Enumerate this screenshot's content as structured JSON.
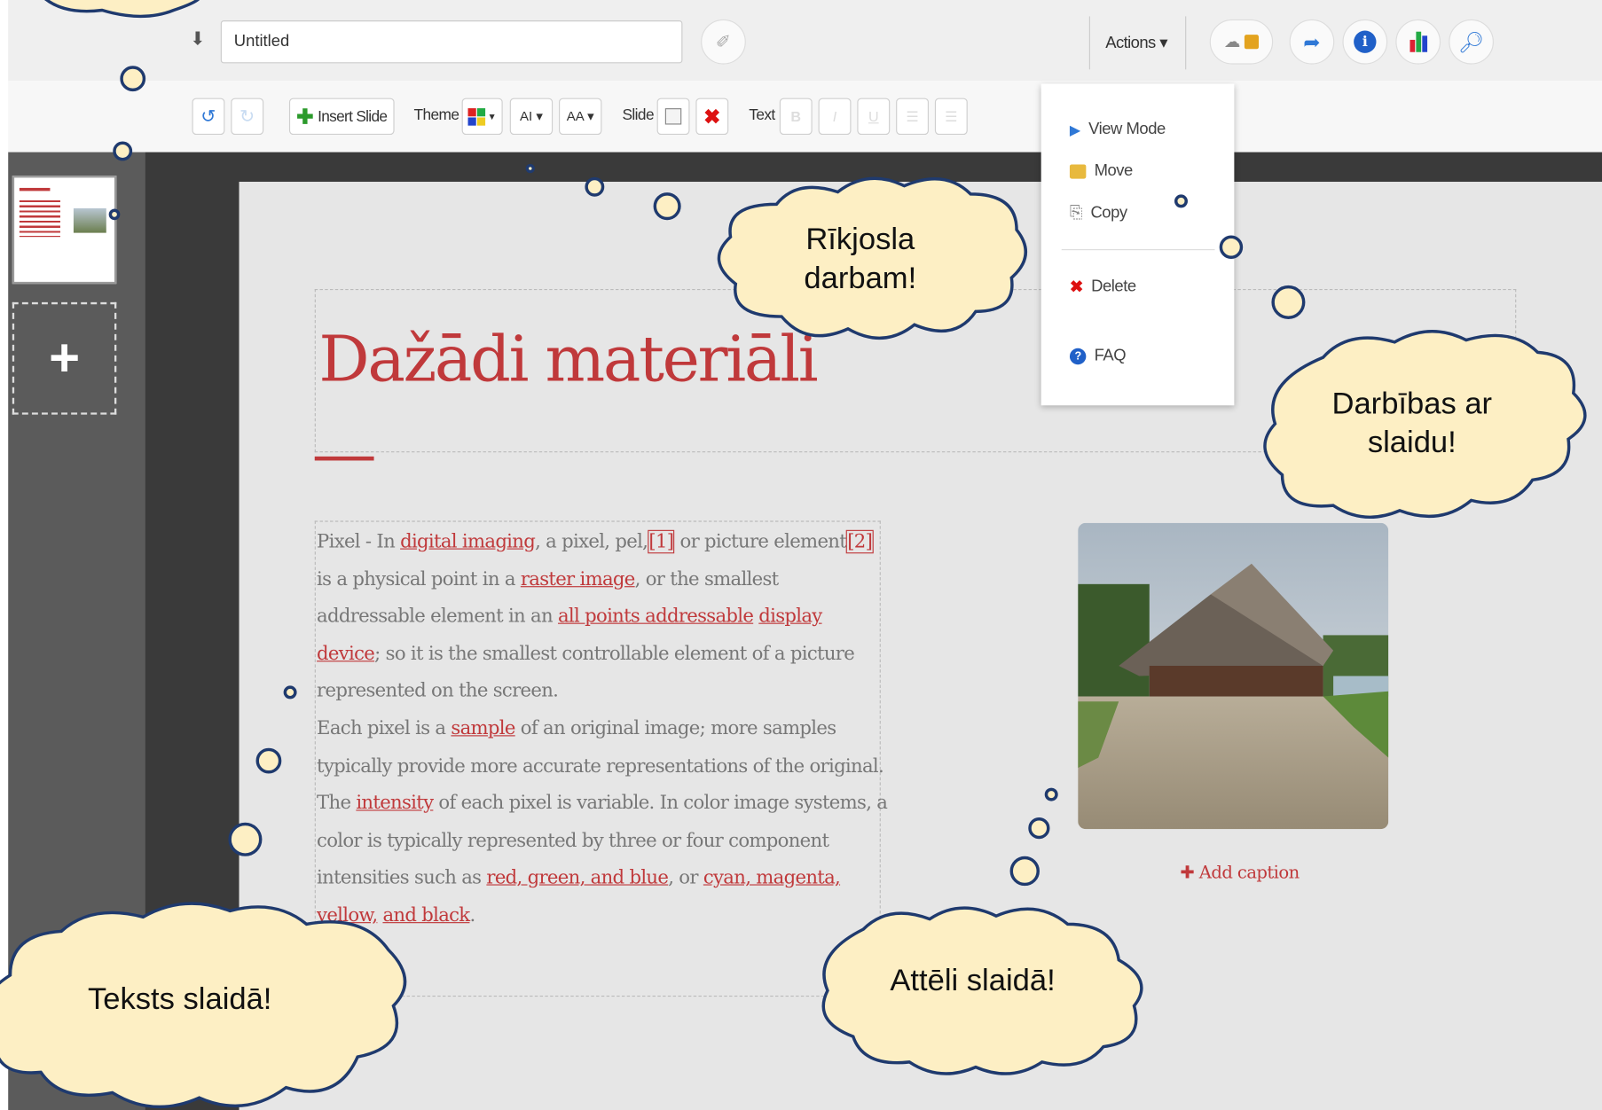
{
  "header": {
    "title_value": "Untitled",
    "actions_label": "Actions ▾"
  },
  "toolbar": {
    "insert_slide": "Insert Slide",
    "theme_label": "Theme",
    "font_btn": "AI ▾",
    "size_btn": "AA ▾",
    "slide_label": "Slide",
    "text_label": "Text",
    "text_buttons": [
      "B",
      "I",
      "U"
    ]
  },
  "actions_menu": {
    "items": [
      {
        "label": "View Mode",
        "icon": "play-icon"
      },
      {
        "label": "Move",
        "icon": "folder-icon"
      },
      {
        "label": "Copy",
        "icon": "copy-icon"
      },
      {
        "label": "Delete",
        "icon": "delete-icon"
      },
      {
        "label": "FAQ",
        "icon": "help-icon"
      }
    ]
  },
  "sidebar": {
    "add_slide": "+"
  },
  "slide": {
    "title": "Dažādi materiāli",
    "image_caption_button": "✚ Add caption",
    "body": {
      "p1": [
        "Pixel - In ",
        "digital imaging",
        ", a pixel, pel,",
        "[1]",
        " or picture element",
        "[2]",
        " is a physical point in a ",
        "raster image",
        ", or the smallest addressable element in an ",
        "all points addressable",
        " ",
        "display device",
        "; so it is the smallest controllable element of a picture represented on the screen."
      ],
      "p2": [
        "Each pixel is a ",
        "sample",
        " of an original image; more samples typically provide more accurate representations of the original. The ",
        "intensity",
        " of each pixel is variable. In color image systems, a color is typically represented by three or four component intensities such as ",
        "red, green, and blue",
        ", or ",
        "cyan, magenta, yellow,",
        " ",
        "and black",
        "."
      ]
    }
  },
  "callouts": {
    "toolbar": [
      "Rīkjosla",
      "darbam!"
    ],
    "actions": [
      "Darbības ar",
      "slaidu!"
    ],
    "text": "Teksts slaidā!",
    "images": "Attēli slaidā!"
  },
  "colors": {
    "accent": "#c0393b",
    "cloud_fill": "#fdefc4",
    "cloud_stroke": "#1f3a6e"
  }
}
